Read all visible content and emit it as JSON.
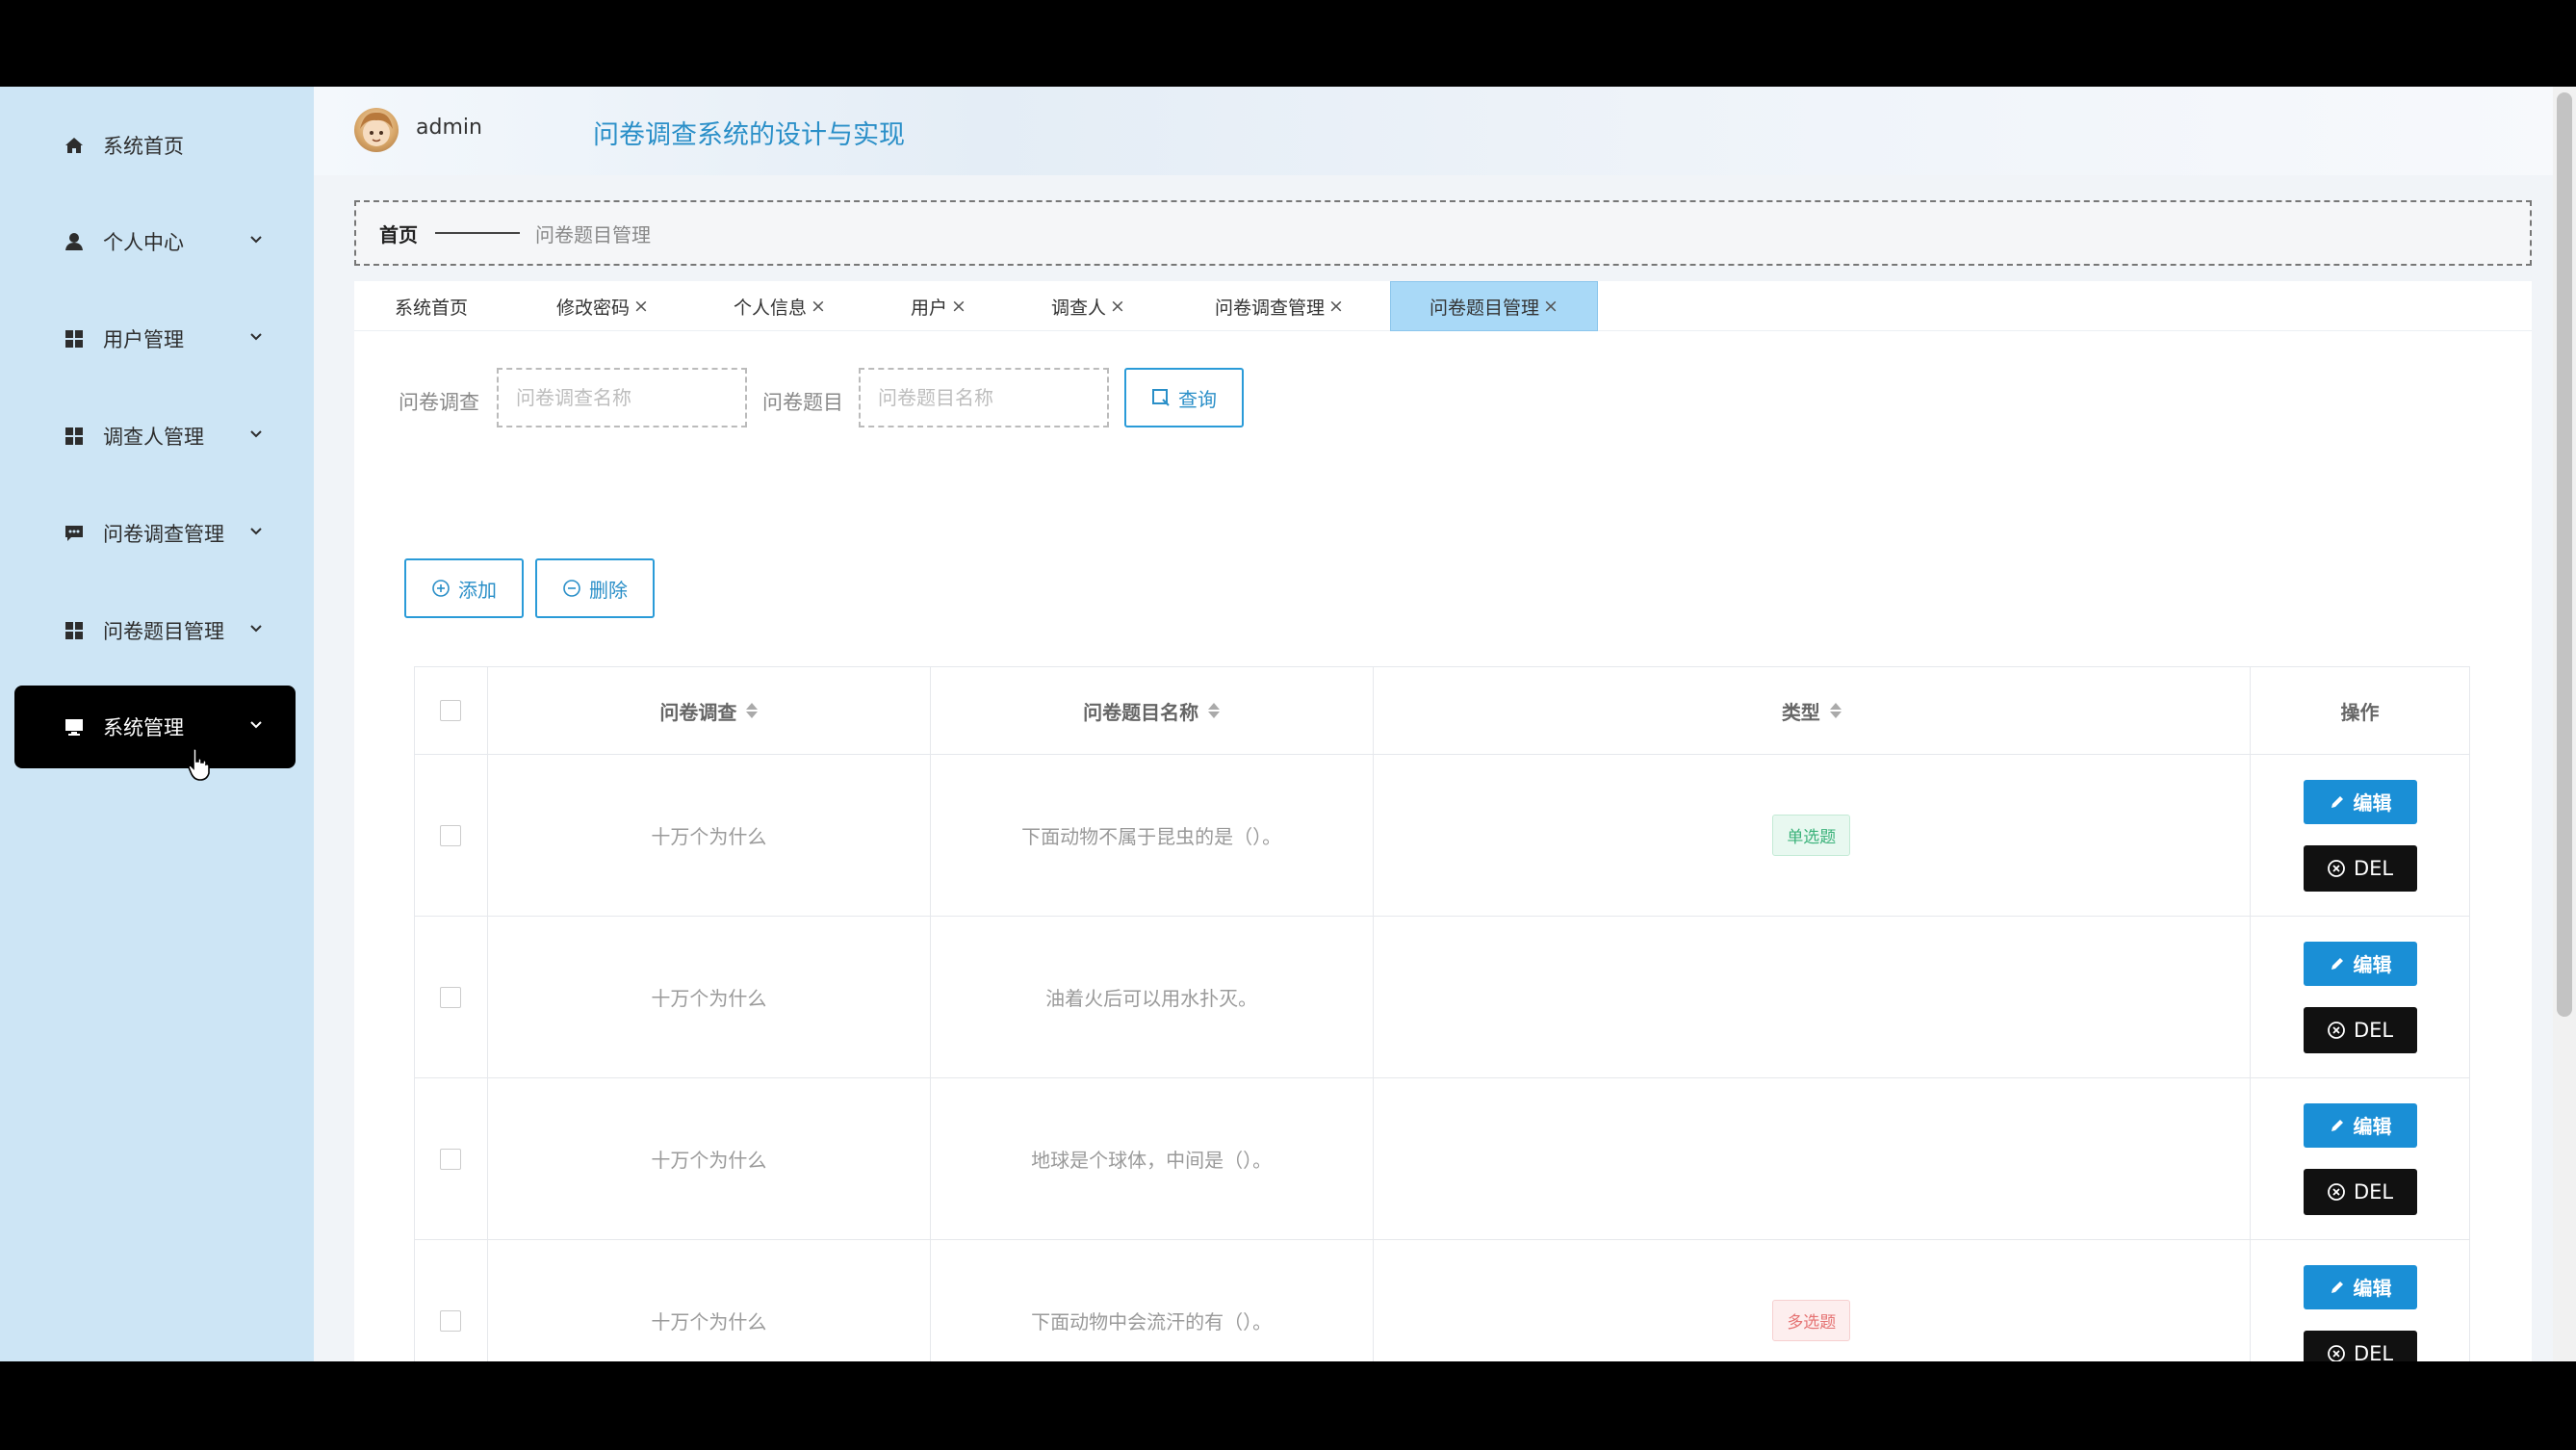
{
  "user": {
    "name": "admin"
  },
  "system_title": "问卷调查系统的设计与实现",
  "sidebar": {
    "items": [
      {
        "label": "系统首页",
        "icon": "home-icon",
        "has_children": false
      },
      {
        "label": "个人中心",
        "icon": "person-icon",
        "has_children": true
      },
      {
        "label": "用户管理",
        "icon": "grid-icon",
        "has_children": true
      },
      {
        "label": "调查人管理",
        "icon": "grid-icon",
        "has_children": true
      },
      {
        "label": "问卷调查管理",
        "icon": "chat-icon",
        "has_children": true
      },
      {
        "label": "问卷题目管理",
        "icon": "grid-icon",
        "has_children": true
      },
      {
        "label": "系统管理",
        "icon": "monitor-icon",
        "has_children": true,
        "active": true
      }
    ]
  },
  "breadcrumb": {
    "home": "首页",
    "current": "问卷题目管理"
  },
  "tabs": [
    {
      "label": "系统首页",
      "closable": false
    },
    {
      "label": "修改密码",
      "closable": true
    },
    {
      "label": "个人信息",
      "closable": true
    },
    {
      "label": "用户",
      "closable": true
    },
    {
      "label": "调查人",
      "closable": true
    },
    {
      "label": "问卷调查管理",
      "closable": true
    },
    {
      "label": "问卷题目管理",
      "closable": true,
      "active": true
    }
  ],
  "tab_close_glyph": "×",
  "search": {
    "survey_label": "问卷调查",
    "survey_placeholder": "问卷调查名称",
    "question_label": "问卷题目",
    "question_placeholder": "问卷题目名称",
    "query_label": "查询"
  },
  "actions": {
    "add_label": "添加",
    "delete_label": "删除"
  },
  "table": {
    "headers": {
      "survey": "问卷调查",
      "question": "问卷题目名称",
      "type": "类型",
      "ops": "操作"
    },
    "edit_label": "编辑",
    "del_label": "DEL",
    "rows": [
      {
        "survey": "十万个为什么",
        "question": "下面动物不属于昆虫的是（）。",
        "type": "单选题",
        "type_color": "green"
      },
      {
        "survey": "十万个为什么",
        "question": "油着火后可以用水扑灭。",
        "type": "",
        "type_color": ""
      },
      {
        "survey": "十万个为什么",
        "question": "地球是个球体，中间是（）。",
        "type": "",
        "type_color": ""
      },
      {
        "survey": "十万个为什么",
        "question": "下面动物中会流汗的有（）。",
        "type": "多选题",
        "type_color": "pink"
      }
    ]
  },
  "colors": {
    "sidebar_bg": "#cde5f5",
    "accent": "#1a8fd6",
    "active_menu": "#000000",
    "active_tab": "#a9d9f7",
    "title": "#2a8fc8"
  }
}
